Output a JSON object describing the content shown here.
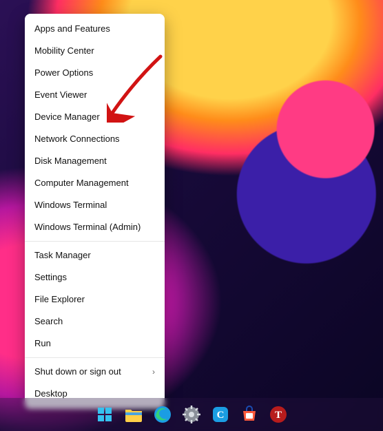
{
  "menu": {
    "groups": [
      [
        {
          "id": "apps-features",
          "label": "Apps and Features"
        },
        {
          "id": "mobility-center",
          "label": "Mobility Center"
        },
        {
          "id": "power-options",
          "label": "Power Options"
        },
        {
          "id": "event-viewer",
          "label": "Event Viewer"
        },
        {
          "id": "device-manager",
          "label": "Device Manager"
        },
        {
          "id": "network-connections",
          "label": "Network Connections"
        },
        {
          "id": "disk-management",
          "label": "Disk Management"
        },
        {
          "id": "computer-management",
          "label": "Computer Management"
        },
        {
          "id": "windows-terminal",
          "label": "Windows Terminal"
        },
        {
          "id": "windows-terminal-admin",
          "label": "Windows Terminal (Admin)"
        }
      ],
      [
        {
          "id": "task-manager",
          "label": "Task Manager"
        },
        {
          "id": "settings",
          "label": "Settings"
        },
        {
          "id": "file-explorer",
          "label": "File Explorer"
        },
        {
          "id": "search",
          "label": "Search"
        },
        {
          "id": "run",
          "label": "Run"
        }
      ],
      [
        {
          "id": "shut-down",
          "label": "Shut down or sign out",
          "submenu": true
        },
        {
          "id": "desktop",
          "label": "Desktop"
        }
      ]
    ]
  },
  "annotation": {
    "target": "device-manager",
    "color": "#d11313"
  },
  "taskbar": {
    "icons": [
      {
        "id": "start",
        "name": "start-icon"
      },
      {
        "id": "explorer",
        "name": "file-explorer-icon"
      },
      {
        "id": "edge",
        "name": "edge-icon"
      },
      {
        "id": "settings",
        "name": "settings-icon"
      },
      {
        "id": "chat",
        "name": "chat-icon"
      },
      {
        "id": "store",
        "name": "store-icon"
      },
      {
        "id": "app-t",
        "name": "app-t-icon"
      }
    ]
  }
}
